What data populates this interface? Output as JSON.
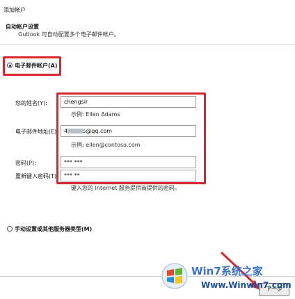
{
  "window": {
    "title": "添加帐户"
  },
  "header": {
    "title": "自动帐户设置",
    "subtitle": "Outlook 可自动配置多个电子邮件帐户。"
  },
  "options": {
    "email_account": "电子邮件帐户(A)",
    "manual_setup": "手动设置或其他服务器类型(M)"
  },
  "form": {
    "name_label": "您的姓名(Y):",
    "name_value": "chengsir",
    "name_hint": "示例: Ellen Adams",
    "email_label": "电子邮件地址(E):",
    "email_prefix": "4",
    "email_suffix": "s@qq.com",
    "email_hint": "示例: ellen@contoso.com",
    "password_label": "密码(P):",
    "password_value": "***    ***",
    "repassword_label": "重新键入密码(T):",
    "repassword_value": "***     **",
    "password_hint": "键入您的 Internet 服务提供商提供的密码。"
  },
  "footer": {
    "next_label": "下一步"
  },
  "watermark": {
    "brand": "Win7系统之家",
    "url": "Www.Winwin7.com"
  },
  "colors": {
    "highlight": "#d8262f",
    "watermark": "#3a73c6"
  }
}
